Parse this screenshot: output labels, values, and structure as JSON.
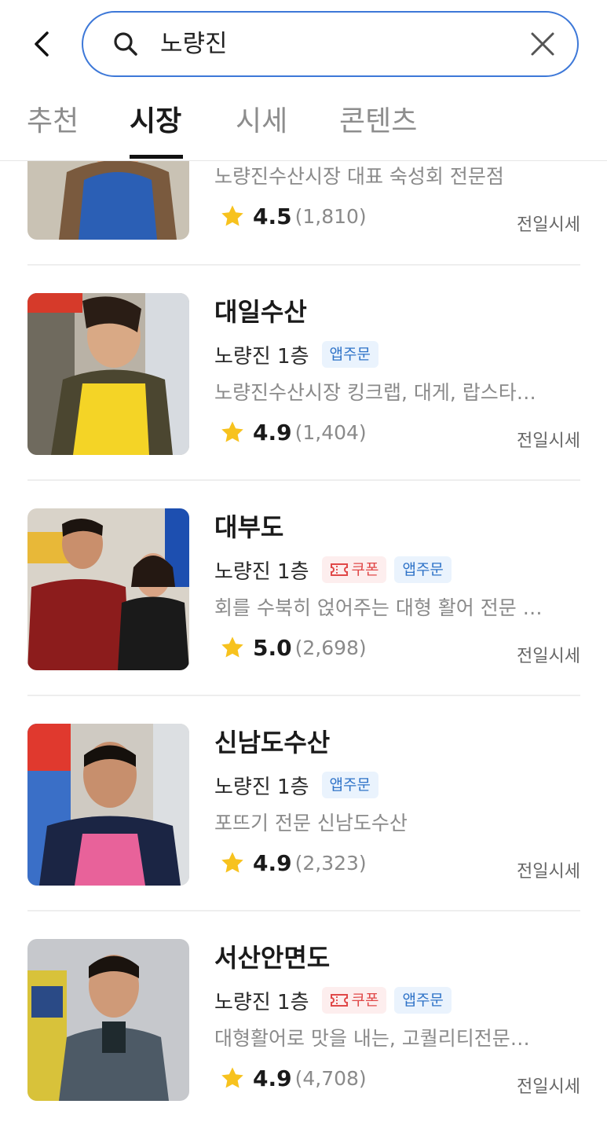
{
  "search": {
    "query": "노량진"
  },
  "tabs": [
    {
      "label": "추천",
      "active": false
    },
    {
      "label": "시장",
      "active": true
    },
    {
      "label": "시세",
      "active": false
    },
    {
      "label": "콘텐츠",
      "active": false
    }
  ],
  "colors": {
    "accent": "#3d78d8",
    "star": "#f7c21e",
    "app_badge_text": "#2f73c8",
    "coupon_badge_text": "#e04848"
  },
  "shops": [
    {
      "name": "",
      "location": "",
      "badges": [],
      "description": "노량진수산시장 대표 숙성회 전문점",
      "rating": "4.5",
      "reviews": "(1,810)",
      "price_link": "전일시세"
    },
    {
      "name": "대일수산",
      "location": "노량진 1층",
      "badges": [
        "앱주문"
      ],
      "description": "노량진수산시장 킹크랩, 대게, 랍스타…",
      "rating": "4.9",
      "reviews": "(1,404)",
      "price_link": "전일시세"
    },
    {
      "name": "대부도",
      "location": "노량진 1층",
      "badges": [
        "쿠폰",
        "앱주문"
      ],
      "description": "회를 수북히 얹어주는 대형 활어 전문 …",
      "rating": "5.0",
      "reviews": "(2,698)",
      "price_link": "전일시세"
    },
    {
      "name": "신남도수산",
      "location": "노량진 1층",
      "badges": [
        "앱주문"
      ],
      "description": "포뜨기 전문 신남도수산",
      "rating": "4.9",
      "reviews": "(2,323)",
      "price_link": "전일시세"
    },
    {
      "name": "서산안면도",
      "location": "노량진 1층",
      "badges": [
        "쿠폰",
        "앱주문"
      ],
      "description": "대형활어로 맛을 내는, 고퀄리티전문…",
      "rating": "4.9",
      "reviews": "(4,708)",
      "price_link": "전일시세"
    }
  ]
}
